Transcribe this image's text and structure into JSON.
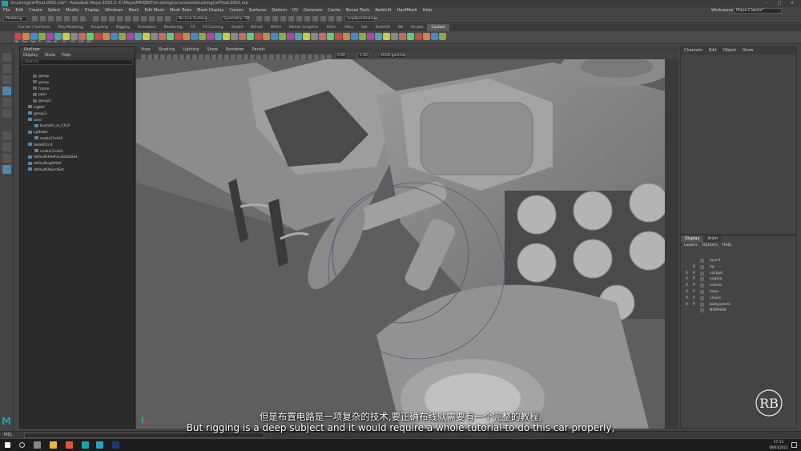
{
  "window": {
    "title": "brushingCarFinal.0001.mb* - Autodesk Maya 2020.3: E:\\Maya\\PROJEKT\\brushingCar\\scenes\\brushingCarFinal.0001.mb",
    "workspace_label": "Workspace :",
    "workspace_value": "Maya Classic*"
  },
  "menubar": [
    "File",
    "Edit",
    "Create",
    "Select",
    "Modify",
    "Display",
    "Windows",
    "Mesh",
    "Edit Mesh",
    "Mesh Tools",
    "Mesh Display",
    "Curves",
    "Surfaces",
    "Deform",
    "UV",
    "Generate",
    "Cache",
    "Bonus Tools",
    "Redshift",
    "HardMesh",
    "Help"
  ],
  "statusline": {
    "mode": "Modeling",
    "live_surface": "No Live Surface",
    "symmetry": "Symmetry: Off",
    "object_name": "rcnpfpsinfmanue"
  },
  "shelf_tabs": [
    "Curves / Surfaces",
    "Poly Modeling",
    "Sculpting",
    "Rigging",
    "Animation",
    "Rendering",
    "FX",
    "FX Caching",
    "Arnold",
    "Bifrost",
    "MASH",
    "Motion Graphics",
    "XGen",
    "VRay",
    "tab",
    "Redshift",
    "BB",
    "Scripts",
    "Custom"
  ],
  "shelf_active_tab": "Custom",
  "shelf_labels": [
    "PBl",
    "Prvl",
    "Def",
    "Pl",
    "Mul",
    "Bl",
    "CP",
    "GTI",
    "GTE",
    "MCI"
  ],
  "outliner": {
    "title": "Outliner",
    "menu": [
      "Display",
      "Show",
      "Help"
    ],
    "search_placeholder": "Search...",
    "items": [
      "group",
      "group",
      "frame",
      "pipe",
      "group1",
      "Lights",
      "group3",
      "Lens",
      "bustatic_in_CtL4",
      "Lpdown",
      "nurbsCircle1",
      "bezelCirc4",
      "nurbsCircle2",
      "defaultHideFaceDataSet",
      "defaultLightSet",
      "defaultObjectSet"
    ]
  },
  "viewport": {
    "menu": [
      "View",
      "Shading",
      "Lighting",
      "Show",
      "Renderer",
      "Panels"
    ],
    "field1": "0.00",
    "field2": "1.00",
    "colorspace": "sRGB gamma"
  },
  "channelbox": {
    "menu": [
      "Channels",
      "Edit",
      "Object",
      "Show"
    ]
  },
  "layers": {
    "tabs": [
      "Display",
      "Anim"
    ],
    "menu": [
      "Layers",
      "Options",
      "Help"
    ],
    "rows": [
      {
        "v": "",
        "p": "",
        "name": "layer1"
      },
      {
        "v": "",
        "p": "R",
        "name": "bg"
      },
      {
        "v": "V",
        "p": "P",
        "name": "cockpit"
      },
      {
        "v": "V",
        "p": "P",
        "name": "engine"
      },
      {
        "v": "V",
        "p": "P",
        "name": "metals"
      },
      {
        "v": "V",
        "p": "P",
        "name": "base"
      },
      {
        "v": "V",
        "p": "P",
        "name": "chasis"
      },
      {
        "v": "V",
        "p": "P",
        "name": "bodypanels"
      },
      {
        "v": "",
        "p": "",
        "name": "NORMAN"
      }
    ]
  },
  "cmdline": {
    "label": "MEL"
  },
  "subtitles": {
    "cn": "但是布置电路是一项复杂的技术,要正确布线就需要有一个完整的教程,",
    "en": "But rigging is a deep subject and it would require a whole tutorial to do this car properly,"
  },
  "watermark": "RB",
  "taskbar": {
    "time": "17:11",
    "date": "09/03/2021"
  },
  "colors": {
    "accent": "#5285a6",
    "maya_teal": "#1aa5a8"
  }
}
